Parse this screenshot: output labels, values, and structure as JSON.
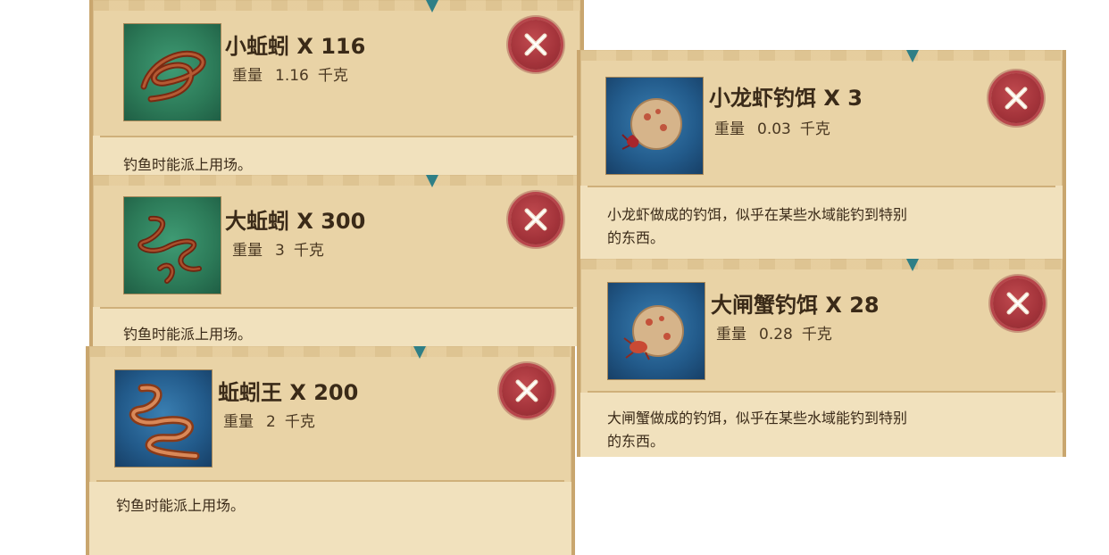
{
  "weight_label": "重量",
  "items": [
    {
      "title": "小蚯蚓 X 116",
      "weight": "1.16",
      "unit": "千克",
      "description": "钓鱼时能派上用场。",
      "icon": "earthworm-small-icon"
    },
    {
      "title": "大蚯蚓 X 300",
      "weight": "3",
      "unit": "千克",
      "description": "钓鱼时能派上用场。",
      "icon": "earthworm-large-icon"
    },
    {
      "title": "蚯蚓王 X 200",
      "weight": "2",
      "unit": "千克",
      "description": "钓鱼时能派上用场。",
      "icon": "earthworm-king-icon"
    },
    {
      "title": "小龙虾钓饵 X 3",
      "weight": "0.03",
      "unit": "千克",
      "description_line1": "小龙虾做成的钓饵，似乎在某些水域能钓到特别",
      "description_line2": "的东西。",
      "icon": "crayfish-bait-icon"
    },
    {
      "title": "大闸蟹钓饵 X 28",
      "weight": "0.28",
      "unit": "千克",
      "description_line1": "大闸蟹做成的钓饵，似乎在某些水域能钓到特别",
      "description_line2": "的东西。",
      "icon": "crab-bait-icon"
    }
  ],
  "colors": {
    "card": "#e9d3a6",
    "discard": "#a3333a",
    "text": "#3a2a18"
  }
}
